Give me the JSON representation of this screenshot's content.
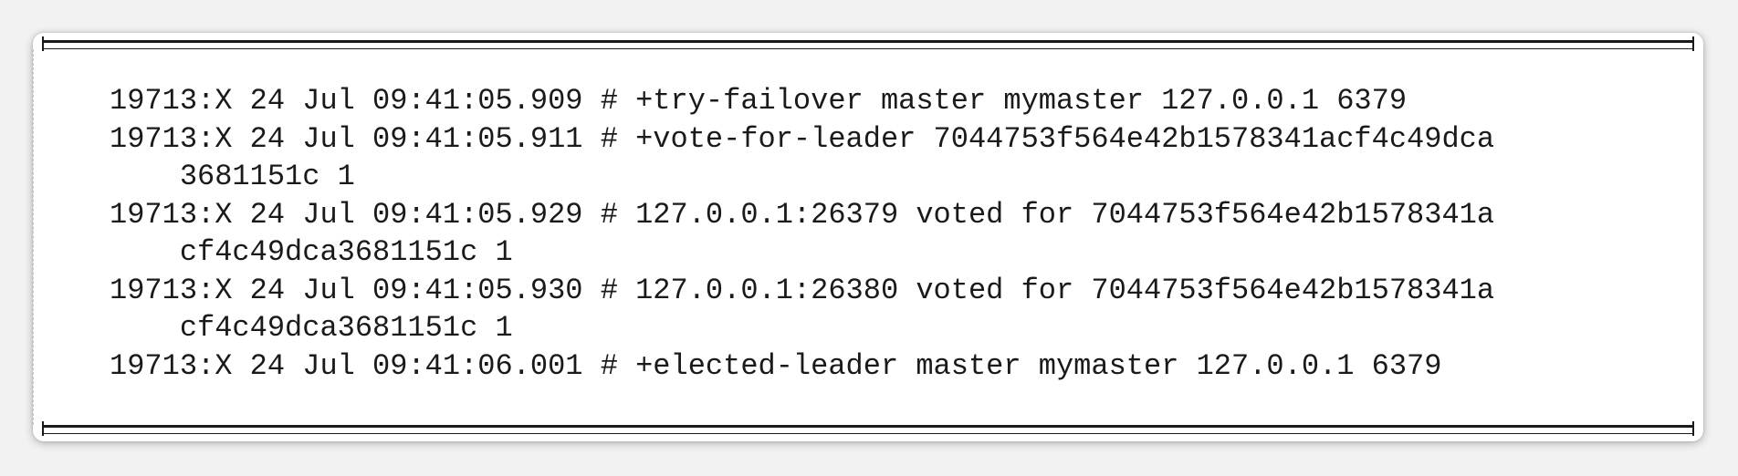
{
  "log": {
    "lines": [
      "19713:X 24 Jul 09:41:05.909 # +try-failover master mymaster 127.0.0.1 6379",
      "19713:X 24 Jul 09:41:05.911 # +vote-for-leader 7044753f564e42b1578341acf4c49dca",
      "    3681151c 1",
      "19713:X 24 Jul 09:41:05.929 # 127.0.0.1:26379 voted for 7044753f564e42b1578341a",
      "    cf4c49dca3681151c 1",
      "19713:X 24 Jul 09:41:05.930 # 127.0.0.1:26380 voted for 7044753f564e42b1578341a",
      "    cf4c49dca3681151c 1",
      "19713:X 24 Jul 09:41:06.001 # +elected-leader master mymaster 127.0.0.1 6379"
    ]
  }
}
